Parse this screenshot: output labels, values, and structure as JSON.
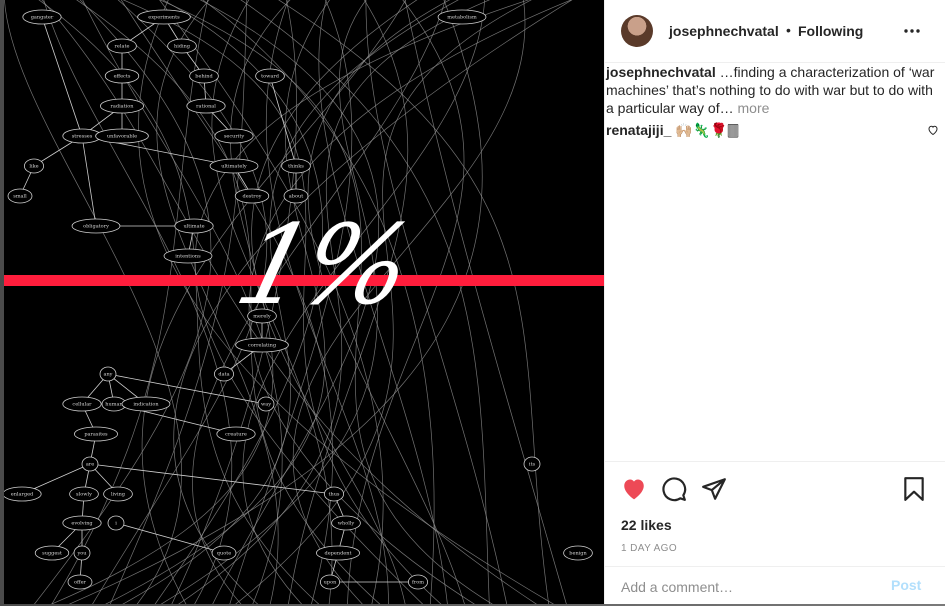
{
  "post": {
    "username": "josephnechvatal",
    "separator": "•",
    "follow_state": "Following",
    "caption_username": "josephnechvatal",
    "caption_text": " …finding a characterization of ‘war machines’ that’s nothing to do with war but to do with a particular way of…",
    "caption_more": " more",
    "comment_username": "renatajiji_",
    "comment_text": " 🙌🏼🦎🌹🀫",
    "likes": "22 likes",
    "time_ago": "1 DAY AGO",
    "comment_placeholder": "Add a comment…",
    "post_label": "Post",
    "like_color": "#ed4956"
  },
  "image": {
    "overlay_text": "1%",
    "bar_color": "#ff1d3c",
    "graph_nodes": [
      "gangster",
      "experiments",
      "relate",
      "hiding",
      "effects",
      "behind",
      "toward",
      "radiation",
      "rational",
      "stresses",
      "unfavorable",
      "security",
      "like",
      "ultimately",
      "thinks",
      "small",
      "destroy",
      "about",
      "obligatory",
      "ultimate",
      "intentions",
      "merely",
      "correlating",
      "data",
      "any",
      "cellular",
      "human",
      "indication",
      "way",
      "parasites",
      "creature",
      "are",
      "enlarged",
      "slowly",
      "living",
      "thus",
      "wholly",
      "evolving",
      "i",
      "suggest",
      "you",
      "quote",
      "dependent",
      "benign",
      "offer",
      "upon",
      "from",
      "metabolism",
      "its"
    ]
  }
}
